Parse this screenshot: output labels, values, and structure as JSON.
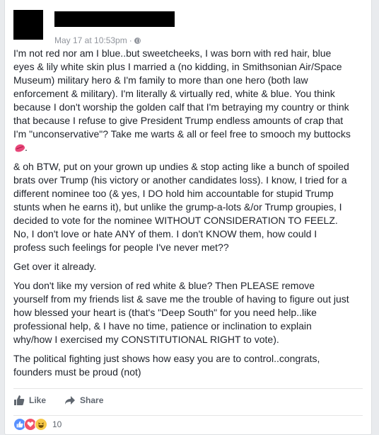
{
  "post": {
    "timestamp": "May 17 at 10:53pm",
    "separator": "·",
    "paragraphs": [
      "I'm not red nor am I blue..but sweetcheeks, I was born with red hair, blue eyes & lily white skin plus I married a (no kidding, in Smithsonian Air/Space Museum) military hero & I'm family to more than one hero (both law enforcement & military). I'm literally & virtually red, white & blue. You think because I don't worship the golden calf that I'm betraying my country or think that because I refuse to give President Trump endless amounts of crap that I'm \"unconservative\"? Take me warts & all or feel free to smooch my buttocks",
      "& oh BTW, put on your grown up undies & stop acting like a bunch of spoiled brats over Trump (his victory or another candidates loss). I know, I tried for a different nominee too (& yes, I DO hold him accountable for stupid Trump stunts when he earns it), but unlike the grump-a-lots &/or Trump groupies, I decided to vote for the nominee WITHOUT CONSIDERATION TO FEELZ. No, I don't love or hate ANY of them. I don't KNOW them, how could I profess such feelings for people I've never met??",
      "Get over it already.",
      "You don't like my version of red white & blue? Then PLEASE remove yourself from my friends list & save me the trouble of having to figure out just how blessed your heart is (that's \"Deep South\" for you need help..like professional help, & I have no time, patience or inclination to explain why/how I exercised my CONSTITUTIONAL RIGHT to vote).",
      "The political fighting just shows how easy you are to control..congrats, founders must be proud (not)"
    ],
    "paragraph1_end": "."
  },
  "actions": {
    "like_label": "Like",
    "share_label": "Share"
  },
  "reactions": {
    "count": "10",
    "types": [
      "like-icon",
      "love-icon",
      "haha-icon"
    ]
  },
  "colors": {
    "accent": "#4267b2",
    "meta_text": "#90949c",
    "action_text": "#606770"
  }
}
